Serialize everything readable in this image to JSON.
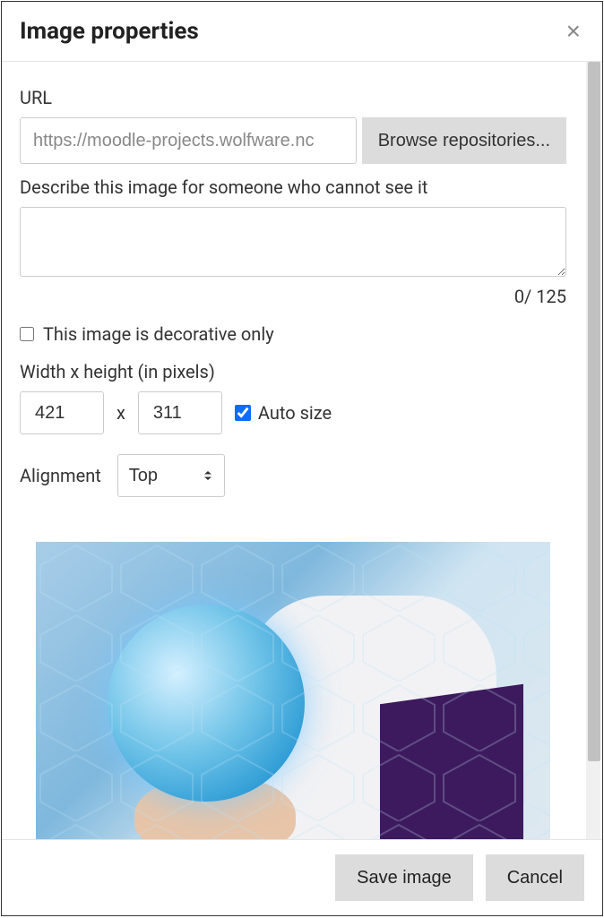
{
  "dialog": {
    "title": "Image properties",
    "url_label": "URL",
    "url_value": "https://moodle-projects.wolfware.nc",
    "browse_label": "Browse repositories...",
    "describe_label": "Describe this image for someone who cannot see it",
    "describe_value": "",
    "char_counter": "0/ 125",
    "decorative_label": "This image is decorative only",
    "decorative_checked": false,
    "size_label": "Width x height (in pixels)",
    "width_value": "421",
    "height_value": "311",
    "x_separator": "x",
    "auto_size_label": "Auto size",
    "auto_size_checked": true,
    "alignment_label": "Alignment",
    "alignment_value": "Top",
    "save_label": "Save image",
    "cancel_label": "Cancel"
  }
}
